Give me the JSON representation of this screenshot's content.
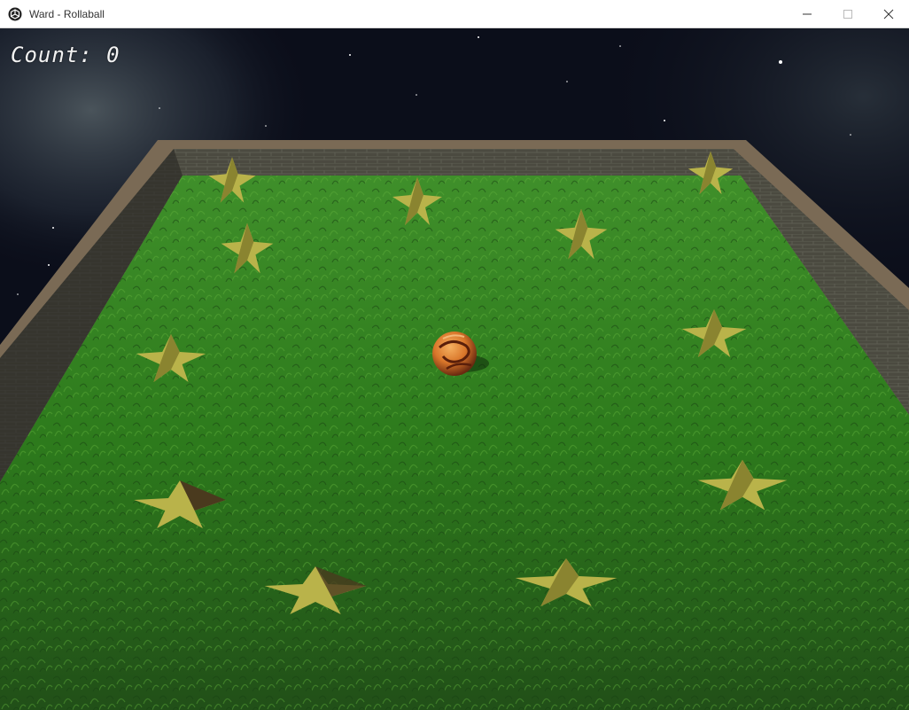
{
  "window": {
    "title": "Ward - Rollaball",
    "controls": {
      "minimize": "minimize-icon",
      "maximize": "maximize-icon",
      "close": "close-icon"
    }
  },
  "hud": {
    "count_text": "Count: 0"
  },
  "colors": {
    "grass": "#2f7a1e",
    "wall_top": "#7a6a55",
    "star": "#b9b34a",
    "ball": "#d9762a",
    "sky": "#0b0e1a"
  }
}
